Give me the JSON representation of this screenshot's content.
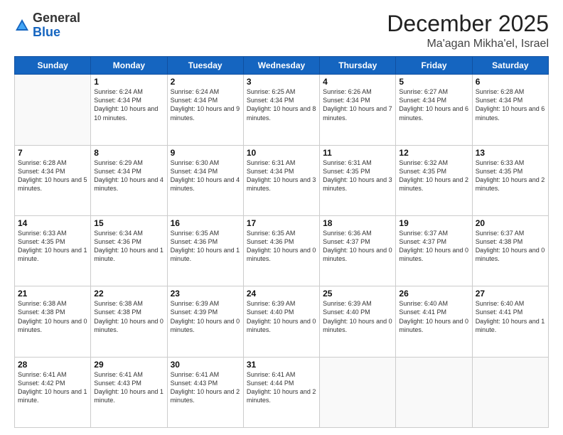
{
  "logo": {
    "general": "General",
    "blue": "Blue"
  },
  "header": {
    "month": "December 2025",
    "location": "Ma'agan Mikha'el, Israel"
  },
  "weekdays": [
    "Sunday",
    "Monday",
    "Tuesday",
    "Wednesday",
    "Thursday",
    "Friday",
    "Saturday"
  ],
  "weeks": [
    [
      {
        "day": "",
        "info": ""
      },
      {
        "day": "1",
        "info": "Sunrise: 6:24 AM\nSunset: 4:34 PM\nDaylight: 10 hours\nand 10 minutes."
      },
      {
        "day": "2",
        "info": "Sunrise: 6:24 AM\nSunset: 4:34 PM\nDaylight: 10 hours\nand 9 minutes."
      },
      {
        "day": "3",
        "info": "Sunrise: 6:25 AM\nSunset: 4:34 PM\nDaylight: 10 hours\nand 8 minutes."
      },
      {
        "day": "4",
        "info": "Sunrise: 6:26 AM\nSunset: 4:34 PM\nDaylight: 10 hours\nand 7 minutes."
      },
      {
        "day": "5",
        "info": "Sunrise: 6:27 AM\nSunset: 4:34 PM\nDaylight: 10 hours\nand 6 minutes."
      },
      {
        "day": "6",
        "info": "Sunrise: 6:28 AM\nSunset: 4:34 PM\nDaylight: 10 hours\nand 6 minutes."
      }
    ],
    [
      {
        "day": "7",
        "info": "Sunrise: 6:28 AM\nSunset: 4:34 PM\nDaylight: 10 hours\nand 5 minutes."
      },
      {
        "day": "8",
        "info": "Sunrise: 6:29 AM\nSunset: 4:34 PM\nDaylight: 10 hours\nand 4 minutes."
      },
      {
        "day": "9",
        "info": "Sunrise: 6:30 AM\nSunset: 4:34 PM\nDaylight: 10 hours\nand 4 minutes."
      },
      {
        "day": "10",
        "info": "Sunrise: 6:31 AM\nSunset: 4:34 PM\nDaylight: 10 hours\nand 3 minutes."
      },
      {
        "day": "11",
        "info": "Sunrise: 6:31 AM\nSunset: 4:35 PM\nDaylight: 10 hours\nand 3 minutes."
      },
      {
        "day": "12",
        "info": "Sunrise: 6:32 AM\nSunset: 4:35 PM\nDaylight: 10 hours\nand 2 minutes."
      },
      {
        "day": "13",
        "info": "Sunrise: 6:33 AM\nSunset: 4:35 PM\nDaylight: 10 hours\nand 2 minutes."
      }
    ],
    [
      {
        "day": "14",
        "info": "Sunrise: 6:33 AM\nSunset: 4:35 PM\nDaylight: 10 hours\nand 1 minute."
      },
      {
        "day": "15",
        "info": "Sunrise: 6:34 AM\nSunset: 4:36 PM\nDaylight: 10 hours\nand 1 minute."
      },
      {
        "day": "16",
        "info": "Sunrise: 6:35 AM\nSunset: 4:36 PM\nDaylight: 10 hours\nand 1 minute."
      },
      {
        "day": "17",
        "info": "Sunrise: 6:35 AM\nSunset: 4:36 PM\nDaylight: 10 hours\nand 0 minutes."
      },
      {
        "day": "18",
        "info": "Sunrise: 6:36 AM\nSunset: 4:37 PM\nDaylight: 10 hours\nand 0 minutes."
      },
      {
        "day": "19",
        "info": "Sunrise: 6:37 AM\nSunset: 4:37 PM\nDaylight: 10 hours\nand 0 minutes."
      },
      {
        "day": "20",
        "info": "Sunrise: 6:37 AM\nSunset: 4:38 PM\nDaylight: 10 hours\nand 0 minutes."
      }
    ],
    [
      {
        "day": "21",
        "info": "Sunrise: 6:38 AM\nSunset: 4:38 PM\nDaylight: 10 hours\nand 0 minutes."
      },
      {
        "day": "22",
        "info": "Sunrise: 6:38 AM\nSunset: 4:38 PM\nDaylight: 10 hours\nand 0 minutes."
      },
      {
        "day": "23",
        "info": "Sunrise: 6:39 AM\nSunset: 4:39 PM\nDaylight: 10 hours\nand 0 minutes."
      },
      {
        "day": "24",
        "info": "Sunrise: 6:39 AM\nSunset: 4:40 PM\nDaylight: 10 hours\nand 0 minutes."
      },
      {
        "day": "25",
        "info": "Sunrise: 6:39 AM\nSunset: 4:40 PM\nDaylight: 10 hours\nand 0 minutes."
      },
      {
        "day": "26",
        "info": "Sunrise: 6:40 AM\nSunset: 4:41 PM\nDaylight: 10 hours\nand 0 minutes."
      },
      {
        "day": "27",
        "info": "Sunrise: 6:40 AM\nSunset: 4:41 PM\nDaylight: 10 hours\nand 1 minute."
      }
    ],
    [
      {
        "day": "28",
        "info": "Sunrise: 6:41 AM\nSunset: 4:42 PM\nDaylight: 10 hours\nand 1 minute."
      },
      {
        "day": "29",
        "info": "Sunrise: 6:41 AM\nSunset: 4:43 PM\nDaylight: 10 hours\nand 1 minute."
      },
      {
        "day": "30",
        "info": "Sunrise: 6:41 AM\nSunset: 4:43 PM\nDaylight: 10 hours\nand 2 minutes."
      },
      {
        "day": "31",
        "info": "Sunrise: 6:41 AM\nSunset: 4:44 PM\nDaylight: 10 hours\nand 2 minutes."
      },
      {
        "day": "",
        "info": ""
      },
      {
        "day": "",
        "info": ""
      },
      {
        "day": "",
        "info": ""
      }
    ]
  ]
}
